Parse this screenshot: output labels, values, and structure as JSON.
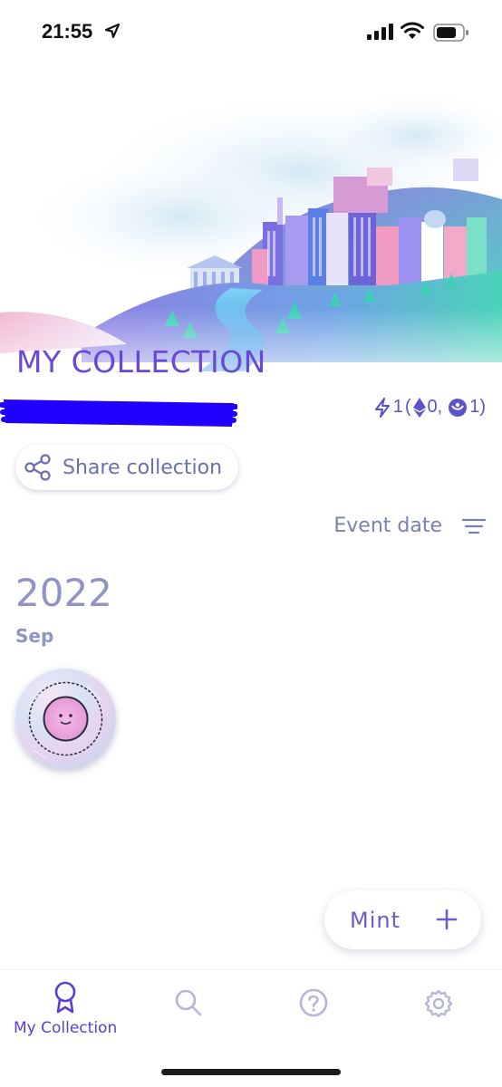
{
  "status_bar": {
    "time": "21:55"
  },
  "header": {
    "title": "MY COLLECTION"
  },
  "stats": {
    "total": "1",
    "open": "(",
    "eth_count": "0,",
    "gnosis_count": "1)"
  },
  "share": {
    "label": "Share collection"
  },
  "sort": {
    "label": "Event date"
  },
  "groups": [
    {
      "year": "2022",
      "month": "Sep"
    }
  ],
  "mint": {
    "label": "Mint"
  },
  "tab_bar": {
    "items": [
      {
        "label": "My Collection"
      }
    ]
  },
  "colors": {
    "accent": "#6a47d9",
    "muted": "#8f93c6",
    "redaction": "#1f00ff"
  }
}
